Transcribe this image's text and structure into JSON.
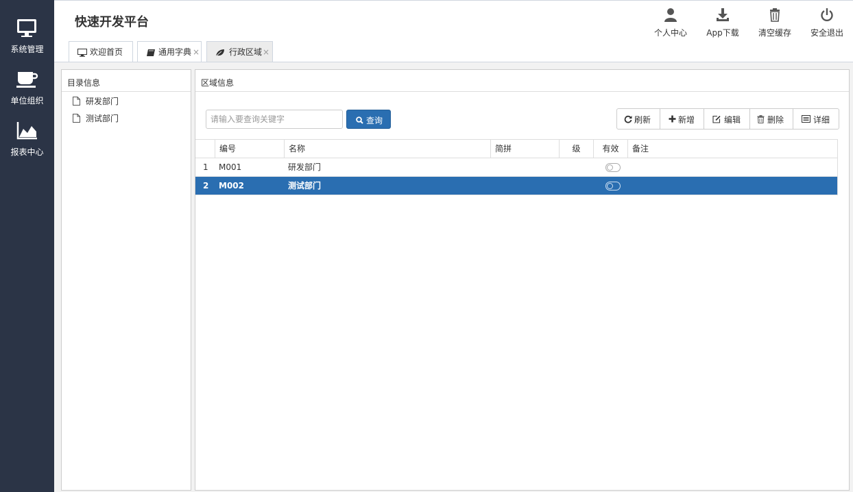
{
  "app": {
    "title": "快速开发平台"
  },
  "leftnav": {
    "items": [
      {
        "label": "系统管理",
        "icon": "monitor-icon"
      },
      {
        "label": "单位组织",
        "icon": "coffee-cup-icon"
      },
      {
        "label": "报表中心",
        "icon": "area-chart-icon"
      }
    ]
  },
  "header": {
    "buttons": [
      {
        "label": "个人中心",
        "icon": "user-icon"
      },
      {
        "label": "App下载",
        "icon": "download-icon"
      },
      {
        "label": "清空缓存",
        "icon": "trash-icon"
      },
      {
        "label": "安全退出",
        "icon": "power-icon"
      }
    ]
  },
  "tabs": [
    {
      "label": "欢迎首页",
      "icon": "desktop-icon",
      "closable": false,
      "active": false
    },
    {
      "label": "通用字典",
      "icon": "book-icon",
      "closable": true,
      "active": false,
      "close": "×"
    },
    {
      "label": "行政区域",
      "icon": "leaf-icon",
      "closable": true,
      "active": true,
      "close": "×"
    }
  ],
  "catalog": {
    "title": "目录信息",
    "items": [
      {
        "label": "研发部门",
        "icon": "file-icon"
      },
      {
        "label": "测试部门",
        "icon": "file-icon"
      }
    ]
  },
  "region": {
    "title": "区域信息",
    "search": {
      "placeholder": "请输入要查询关键字",
      "button_label": "查询"
    },
    "toolbar": {
      "refresh": "刷新",
      "add": "新增",
      "edit": "编辑",
      "delete": "删除",
      "detail": "详细"
    },
    "grid": {
      "columns": [
        "编号",
        "名称",
        "简拼",
        "级",
        "有效",
        "备注"
      ],
      "rows": [
        {
          "index": "1",
          "code": "M001",
          "name": "研发部门",
          "abbr": "",
          "level": "",
          "valid": false,
          "note": ""
        },
        {
          "index": "2",
          "code": "M002",
          "name": "测试部门",
          "abbr": "",
          "level": "",
          "valid": false,
          "note": "",
          "selected": true
        }
      ]
    }
  },
  "colors": {
    "sidebar": "#2b3446",
    "accent": "#2a6eb1"
  }
}
